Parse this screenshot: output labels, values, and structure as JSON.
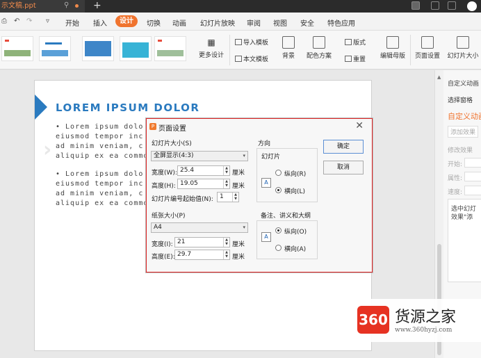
{
  "titlebar": {
    "doc_tab": "示文稿.ppt",
    "new_tab": "+"
  },
  "menubar": {
    "items": [
      "开始",
      "插入",
      "设计",
      "切换",
      "动画",
      "幻灯片放映",
      "审阅",
      "视图",
      "安全",
      "特色应用"
    ],
    "active": "设计"
  },
  "ribbon": {
    "more_design": "更多设计",
    "import_template": "导入模板",
    "doc_template": "本文模板",
    "background": "背景",
    "color_scheme": "配色方案",
    "layout": "版式",
    "reset": "重置",
    "edit_master": "编辑母版",
    "page_setup": "页面设置",
    "slide_size": "幻灯片大小"
  },
  "slide": {
    "title": "LOREM IPSUM DOLOR",
    "bullet1": [
      "• Lorem ipsum dolo",
      "eiusmod tempor inc",
      "ad minim veniam, c",
      "aliquip ex ea commo"
    ],
    "bullet2": [
      "• Lorem ipsum dolo",
      "eiusmod tempor inc",
      "ad minim veniam, c",
      "aliquip ex ea commo"
    ]
  },
  "pane": {
    "custom_anim": "自定义动画",
    "select_pane": "选择窗格",
    "heading": "自定义动画",
    "add_effect": "添加效果",
    "modify": "修改效果",
    "start": "开始:",
    "property": "属性:",
    "speed": "速度:",
    "hint": [
      "选中幻灯",
      "效果\"添"
    ]
  },
  "dialog": {
    "title": "页面设置",
    "slide_size_label": "幻灯片大小(S)",
    "slide_size_value": "全屏显示(4:3)",
    "width_label": "宽度(W):",
    "width_value": "25.4",
    "height_label": "高度(H):",
    "height_value": "19.05",
    "unit": "厘米",
    "start_num_label": "幻灯片编号起始值(N):",
    "start_num_value": "1",
    "paper_size_label": "纸张大小(P)",
    "paper_size_value": "A4",
    "paper_width_label": "宽度(I):",
    "paper_width_value": "21",
    "paper_height_label": "高度(E):",
    "paper_height_value": "29.7",
    "orientation_label": "方向",
    "slides_label": "幻灯片",
    "portrait": "纵向(R)",
    "landscape": "横向(L)",
    "notes_label": "备注、讲义和大纲",
    "notes_portrait": "纵向(O)",
    "notes_landscape": "横向(A)",
    "ok": "确定",
    "cancel": "取消"
  },
  "watermark": {
    "badge": "360",
    "title": "货源之家",
    "url": "www.360hyzj.com"
  }
}
